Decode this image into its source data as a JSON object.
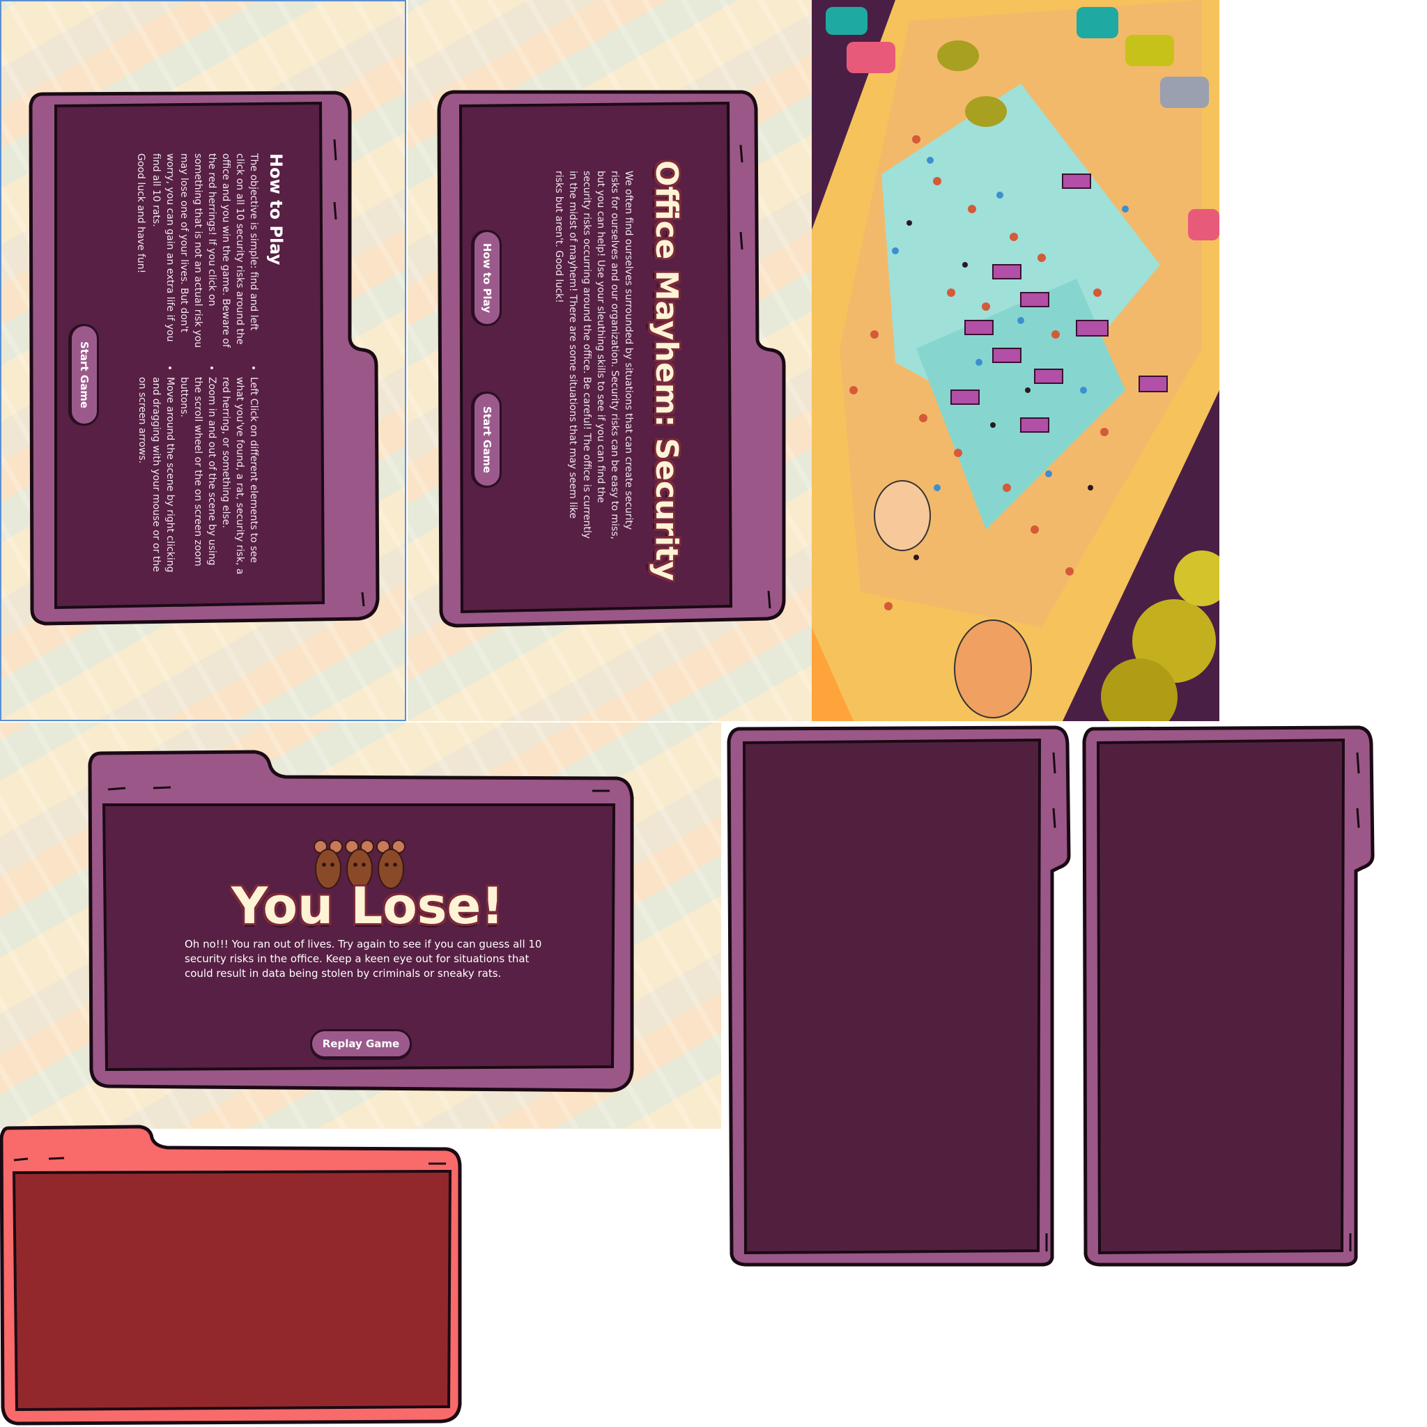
{
  "colors": {
    "folder_outer": "#9b5788",
    "folder_inner": "#572044",
    "folder_red_outer": "#f96a6a",
    "folder_red_inner": "#93282c",
    "button": "#9c5a8c",
    "title_fill": "#fff3d6",
    "title_outline": "#7a2a3a"
  },
  "how_to_play": {
    "title": "How to Play",
    "intro": "The objective is simple: find and left click on all 10 security risks around the office and you win the game. Beware of the red herrings! If you click on something that is not an actual risk you may lose one of your lives. But don't worry, you can gain an extra life if you find all 10 rats.",
    "closing": "Good luck and have fun!",
    "bullets": [
      "Left Click on different elements to see what you've found, a rat, security risk, a red herring, or something else.",
      "Zoom in and out of the scene by using the scroll wheel or the on screen zoom buttons.",
      "Move around the scene by right clicking and dragging with your mouse or or the on screen arrows."
    ],
    "start_button": "Start Game"
  },
  "intro_panel": {
    "title": "Office Mayhem: Security",
    "body": "We often find ourselves surrounded by situations that can create security risks for ourselves and our organization. Security risks can be easy to miss, but you can help! Use your sleuthing skills to see if you can find the security risks occurring around the office. Be careful! The office is currently in the midst of mayhem! There are some situations that may seem like risks but aren't. Good luck!",
    "how_button": "How to Play",
    "start_button": "Start Game"
  },
  "lose_panel": {
    "title": "You Lose!",
    "body": "Oh no!!! You ran out of lives. Try again to see if you can guess all 10 security risks in the office. Keep a keen eye out for situations that could result in data being stolen by criminals or sneaky rats.",
    "replay_button": "Replay Game",
    "rats_icon": "three-rats-icon"
  },
  "scene": {
    "icon": "office-illustration"
  }
}
